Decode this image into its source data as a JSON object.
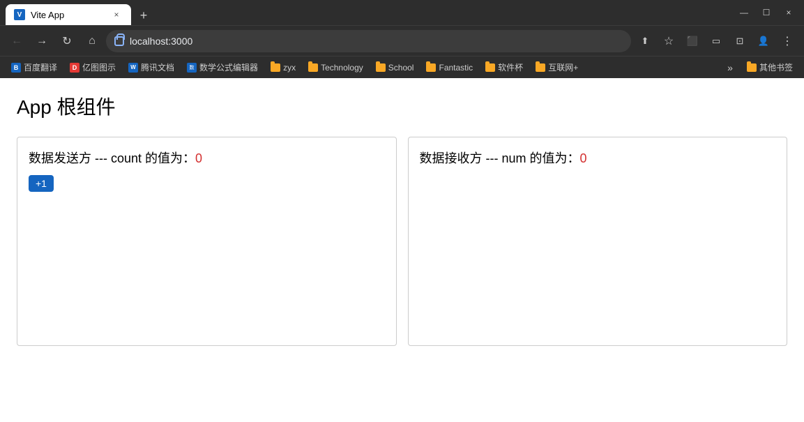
{
  "browser": {
    "tab": {
      "favicon_label": "V",
      "title": "Vite App",
      "close_label": "×"
    },
    "new_tab_label": "+",
    "controls": {
      "minimize": "—",
      "maximize": "☐",
      "close": "×"
    },
    "toolbar": {
      "back_label": "←",
      "forward_label": "→",
      "reload_label": "↻",
      "home_label": "⌂",
      "url": "localhost:3000",
      "share_label": "⬆",
      "star_label": "☆",
      "extension_label": "⬜",
      "cast_label": "⬜",
      "split_label": "⬜",
      "profile_label": "👤",
      "menu_label": "⋮"
    },
    "bookmarks": [
      {
        "id": "baidu",
        "icon": "B",
        "icon_color": "#1565c0",
        "label": "百度翻译",
        "type": "link"
      },
      {
        "id": "yitu",
        "icon": "D",
        "icon_color": "#e53935",
        "label": "亿图图示",
        "type": "link"
      },
      {
        "id": "tencent",
        "icon": "W",
        "icon_color": "#1565c0",
        "label": "腾讯文档",
        "type": "link"
      },
      {
        "id": "math",
        "icon": "数",
        "icon_color": "#1565c0",
        "label": "数学公式编辑器",
        "type": "link"
      },
      {
        "id": "zyx",
        "icon": "📁",
        "label": "zyx",
        "type": "folder"
      },
      {
        "id": "technology",
        "icon": "📁",
        "label": "Technology",
        "type": "folder"
      },
      {
        "id": "school",
        "icon": "📁",
        "label": "School",
        "type": "folder"
      },
      {
        "id": "fantastic",
        "icon": "📁",
        "label": "Fantastic",
        "type": "folder"
      },
      {
        "id": "software",
        "icon": "📁",
        "label": "软件杯",
        "type": "folder"
      },
      {
        "id": "internet",
        "icon": "📁",
        "label": "互联网+",
        "type": "folder"
      }
    ],
    "overflow_label": "»",
    "other_bookmarks_label": "其他书签"
  },
  "page": {
    "title": "App 根组件",
    "sender_panel": {
      "text_prefix": "数据发送方 --- count 的值为：",
      "count_value": "0",
      "button_label": "+1"
    },
    "receiver_panel": {
      "text_prefix": "数据接收方 --- num 的值为：",
      "num_value": "0"
    }
  }
}
